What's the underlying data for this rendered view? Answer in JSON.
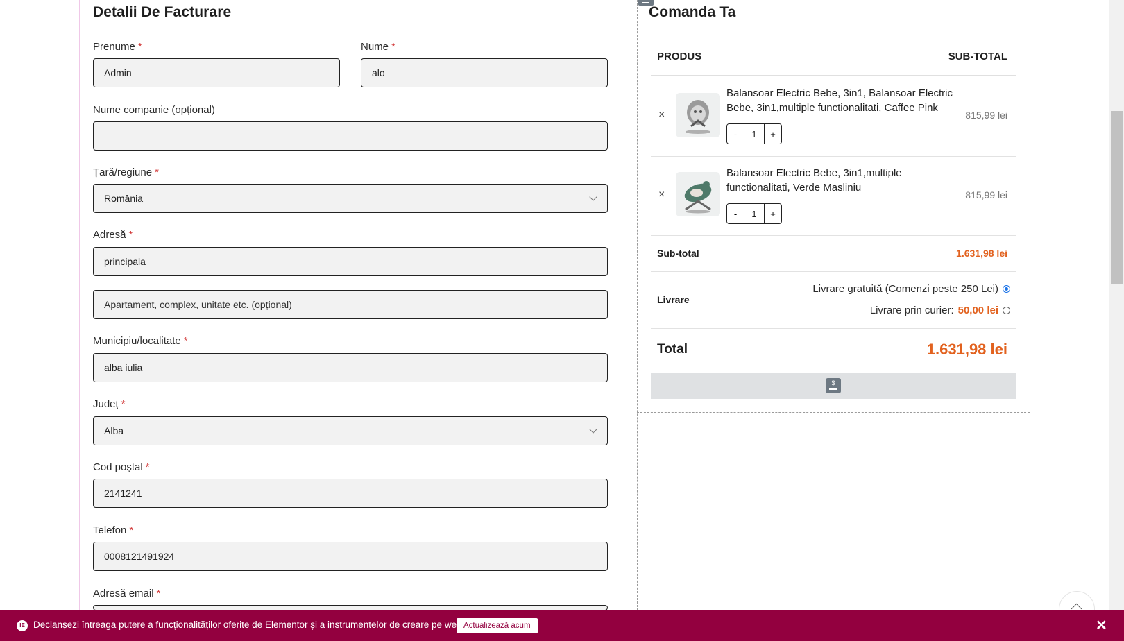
{
  "billing": {
    "title": "Detalii De Facturare",
    "first_name": {
      "label": "Prenume",
      "value": "Admin"
    },
    "last_name": {
      "label": "Nume",
      "value": "alo"
    },
    "company": {
      "label": "Nume companie (opțional)",
      "value": ""
    },
    "country": {
      "label": "Țară/regiune",
      "value": "România"
    },
    "address": {
      "label": "Adresă",
      "value": "principala",
      "placeholder2": "Apartament, complex, unitate etc. (opțional)"
    },
    "city": {
      "label": "Municipiu/localitate",
      "value": "alba iulia"
    },
    "county": {
      "label": "Județ",
      "value": "Alba"
    },
    "postcode": {
      "label": "Cod poștal",
      "value": "2141241"
    },
    "phone": {
      "label": "Telefon",
      "value": "0008121491924"
    },
    "email": {
      "label": "Adresă email"
    },
    "required_mark": "*"
  },
  "order": {
    "title": "Comanda Ta",
    "col_product": "PRODUS",
    "col_subtotal": "SUB-TOTAL",
    "items": [
      {
        "name": "Balansoar Electric Bebe, 3in1, Balansoar Electric Bebe, 3in1,multiple functionalitati, Caffee Pink",
        "qty": "1",
        "price": "815,99 lei"
      },
      {
        "name": "Balansoar Electric Bebe, 3in1,multiple functionalitati, Verde Masliniu",
        "qty": "1",
        "price": "815,99 lei"
      }
    ],
    "remove_symbol": "×",
    "minus": "-",
    "plus": "+",
    "subtotal_label": "Sub-total",
    "subtotal_value": "1.631,98 lei",
    "shipping_label": "Livrare",
    "shipping_free": "Livrare gratuită (Comenzi peste 250 Lei)",
    "shipping_courier": "Livrare prin curier:",
    "shipping_courier_price": "50,00 lei",
    "total_label": "Total",
    "total_value": "1.631,98 lei",
    "pay_icon": "$"
  },
  "notice": {
    "text": "Declanșezi întreaga putere a funcționalităților oferite de Elementor și a instrumentelor de creare pe web.",
    "button": "Actualizează acum",
    "close": "✕",
    "logo": "IE"
  },
  "colors": {
    "accent": "#e2621f",
    "notice_bg": "#93003f",
    "required": "#d23a3a"
  }
}
